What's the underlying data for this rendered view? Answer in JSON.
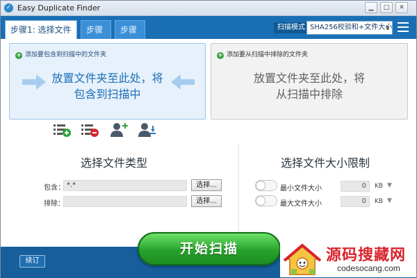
{
  "window": {
    "title": "Easy Duplicate Finder",
    "icon": "app-check-icon",
    "controls": [
      "minimize-icon",
      "maximize-icon",
      "close-icon"
    ]
  },
  "tabs": [
    {
      "label": "步骤1: 选择文件夹",
      "active": true
    },
    {
      "label": "步骤2",
      "active": false
    },
    {
      "label": "步骤3",
      "active": false
    }
  ],
  "scan_mode": {
    "label": "扫描模式",
    "value": "SHA256校验和+文件大小"
  },
  "include_box": {
    "header": "添加要包含到扫描中的文件夹",
    "text_line1": "放置文件夹至此处，将",
    "text_line2": "包含到扫描中"
  },
  "exclude_box": {
    "header": "添加要从扫描中排除的文件夹",
    "text_line1": "放置文件夹至此处，将",
    "text_line2": "从扫描中排除"
  },
  "action_icons": [
    "add-list-icon",
    "remove-list-icon",
    "add-user-icon",
    "user-download-icon"
  ],
  "file_type": {
    "title": "选择文件类型",
    "include_label": "包含：",
    "include_value": "*.*",
    "exclude_label": "排除：",
    "exclude_value": "",
    "browse_label": "选择..."
  },
  "file_size": {
    "title": "选择文件大小限制",
    "min_label": "最小文件大小",
    "min_value": "0",
    "max_label": "最大文件大小",
    "max_value": "0",
    "unit": "KB"
  },
  "footer": {
    "order_label": "续订",
    "start_label": "开始扫描"
  },
  "watermark": {
    "title": "源码搜藏网",
    "subtitle": "codesocang.com"
  },
  "colors": {
    "accent": "#1a6fb4",
    "start_green": "#27a32b",
    "watermark_red": "#d9232d"
  }
}
